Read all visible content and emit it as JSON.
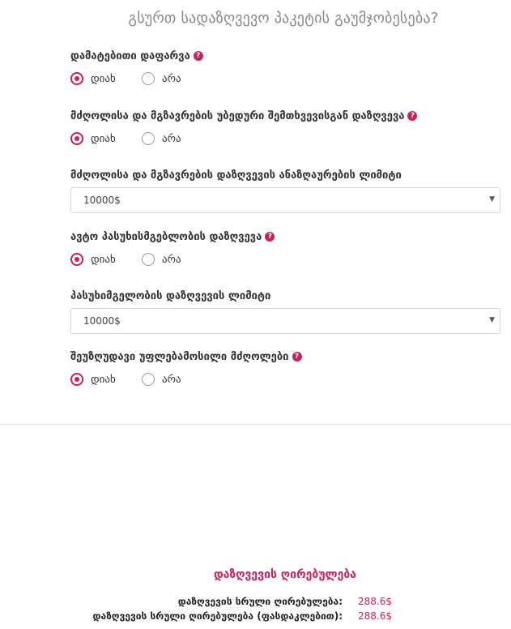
{
  "header": {
    "title": "გსურთ სადაზღვევო პაკეტის გაუმჯობესება?"
  },
  "questions": [
    {
      "label": "დამატებითი დაფარვა",
      "has_help": true,
      "options": [
        {
          "label": "დიახ",
          "selected": true
        },
        {
          "label": "არა",
          "selected": false
        }
      ]
    },
    {
      "label": "მძღოლისა და მგზავრების უბედური შემთხვევისგან დაზღვევა",
      "has_help": true,
      "options": [
        {
          "label": "დიახ",
          "selected": true
        },
        {
          "label": "არა",
          "selected": false
        }
      ]
    },
    {
      "label": "მძღოლისა და მგზავრების დაზღვევის ანაზღაურების ლიმიტი",
      "has_help": false,
      "select_value": "10000$"
    },
    {
      "label": "ავტო პასუხისმგებლობის დაზღვევა",
      "has_help": true,
      "options": [
        {
          "label": "დიახ",
          "selected": true
        },
        {
          "label": "არა",
          "selected": false
        }
      ]
    },
    {
      "label": "პასუხიმგელობის დაზღვევის ლიმიტი",
      "has_help": false,
      "select_value": "10000$"
    },
    {
      "label": "შეუზღუდავი უფლებამოსილი მძღოლები",
      "has_help": true,
      "options": [
        {
          "label": "დიახ",
          "selected": true
        },
        {
          "label": "არა",
          "selected": false
        }
      ]
    }
  ],
  "help_icon_glyph": "?",
  "select_caret_glyph": "▼",
  "cost": {
    "title": "დაზღვევის ღირებულება",
    "rows": [
      {
        "label": "დაზღვევის სრული ღირებულება:",
        "value": "288.6$"
      },
      {
        "label": "დაზღვევის სრული ღირებულება (ფასდაკლებით):",
        "value": "288.6$"
      }
    ]
  },
  "colors": {
    "accent": "#c9215e",
    "title_gray": "#888888",
    "text": "#333333",
    "border": "#d6d6d6"
  }
}
